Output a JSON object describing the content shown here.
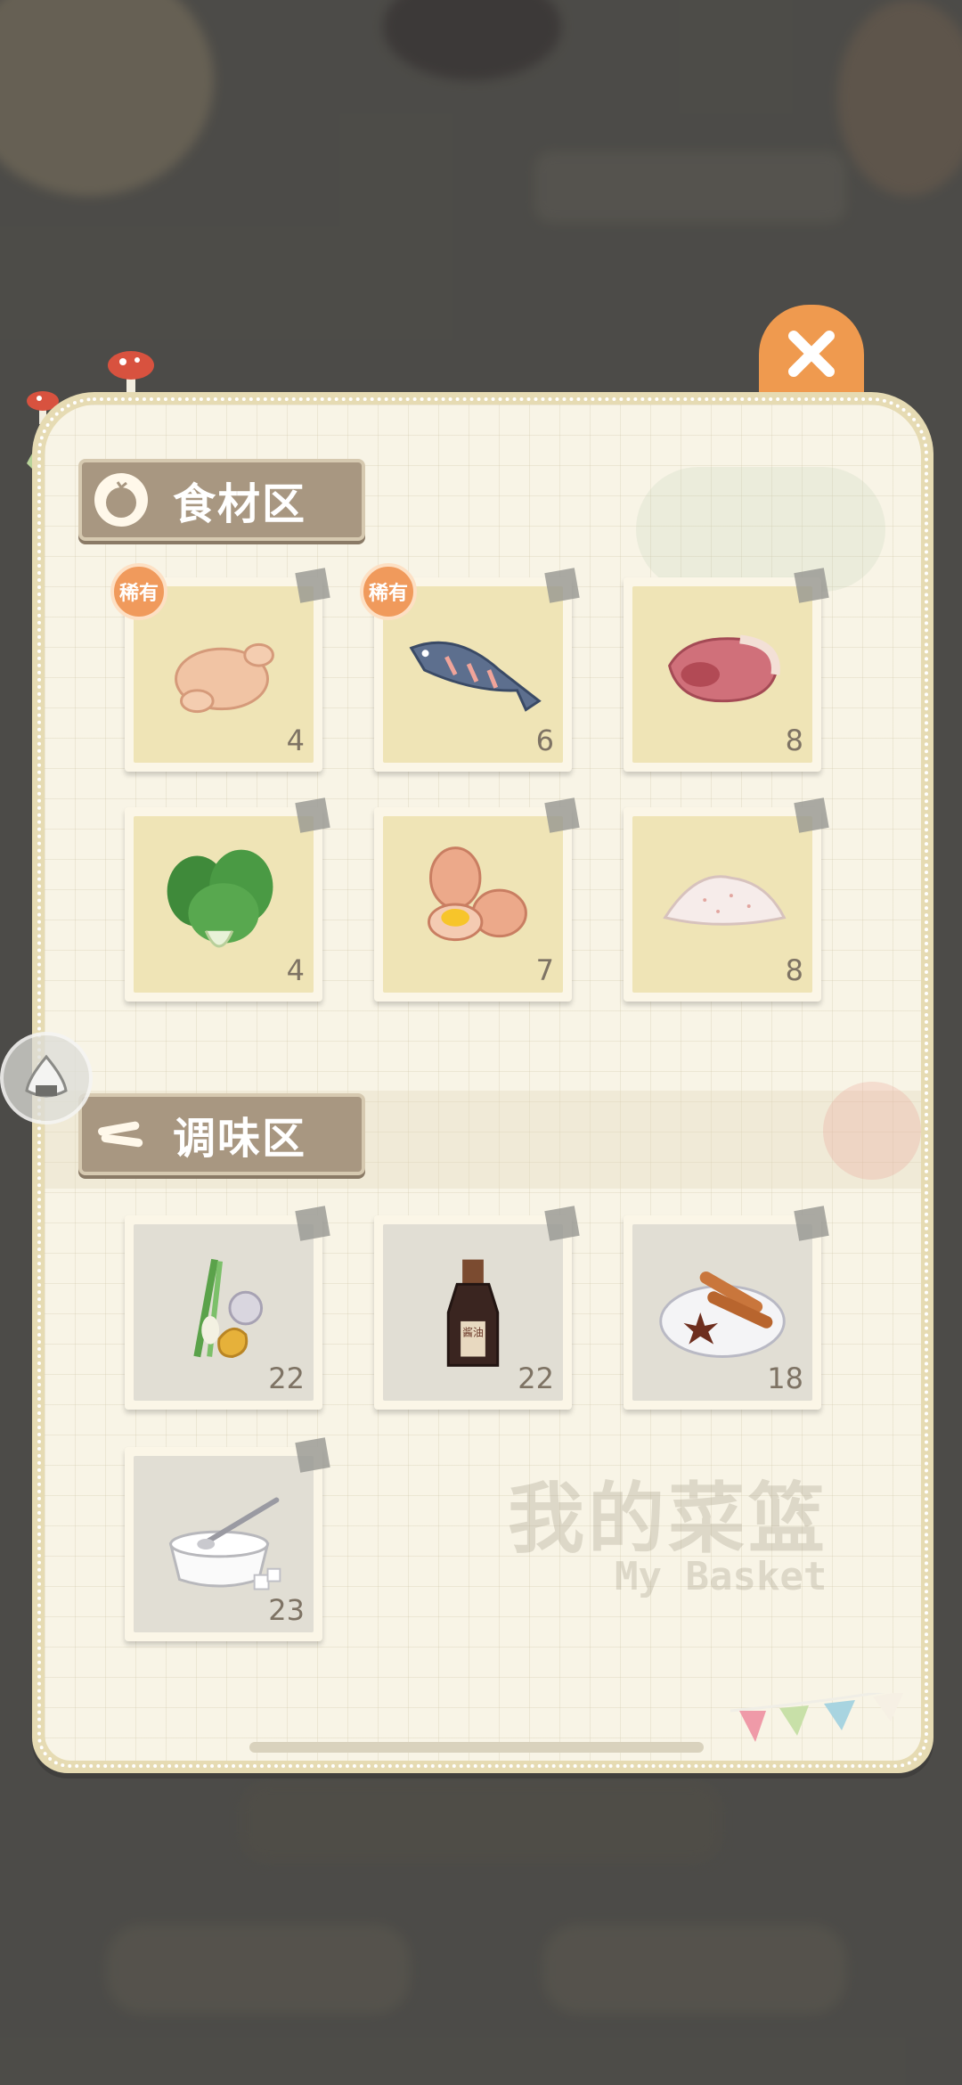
{
  "title_cn": "我的菜篮",
  "title_en": "My Basket",
  "sections": [
    {
      "label": "食材区",
      "icon": "tomato-icon",
      "items": [
        {
          "name": "chicken",
          "icon": "chicken-icon",
          "qty": "4",
          "rare": true
        },
        {
          "name": "fish",
          "icon": "fish-icon",
          "qty": "6",
          "rare": true
        },
        {
          "name": "meat",
          "icon": "meat-icon",
          "qty": "8",
          "rare": false
        },
        {
          "name": "bok-choy",
          "icon": "bok-choy-icon",
          "qty": "4",
          "rare": false
        },
        {
          "name": "eggs",
          "icon": "eggs-icon",
          "qty": "7",
          "rare": false
        },
        {
          "name": "salt",
          "icon": "salt-pile-icon",
          "qty": "8",
          "rare": false
        }
      ]
    },
    {
      "label": "调味区",
      "icon": "cinnamon-icon",
      "items": [
        {
          "name": "scallion-ginger-garlic",
          "icon": "scallion-ginger-garlic-icon",
          "qty": "22",
          "rare": false
        },
        {
          "name": "soy-sauce",
          "icon": "soy-sauce-bottle-icon",
          "qty": "22",
          "rare": false,
          "bottle_label": "酱油"
        },
        {
          "name": "spices",
          "icon": "star-anise-cinnamon-icon",
          "qty": "18",
          "rare": false
        },
        {
          "name": "sugar",
          "icon": "sugar-bowl-icon",
          "qty": "23",
          "rare": false
        }
      ]
    }
  ],
  "rare_badge_label": "稀有",
  "colors": {
    "panel_border": "#e6dbb3",
    "panel_bg": "#f8f4e6",
    "header_bg": "#a89781",
    "close_button": "#ef9a4f",
    "rare_badge": "#f09a5c"
  }
}
